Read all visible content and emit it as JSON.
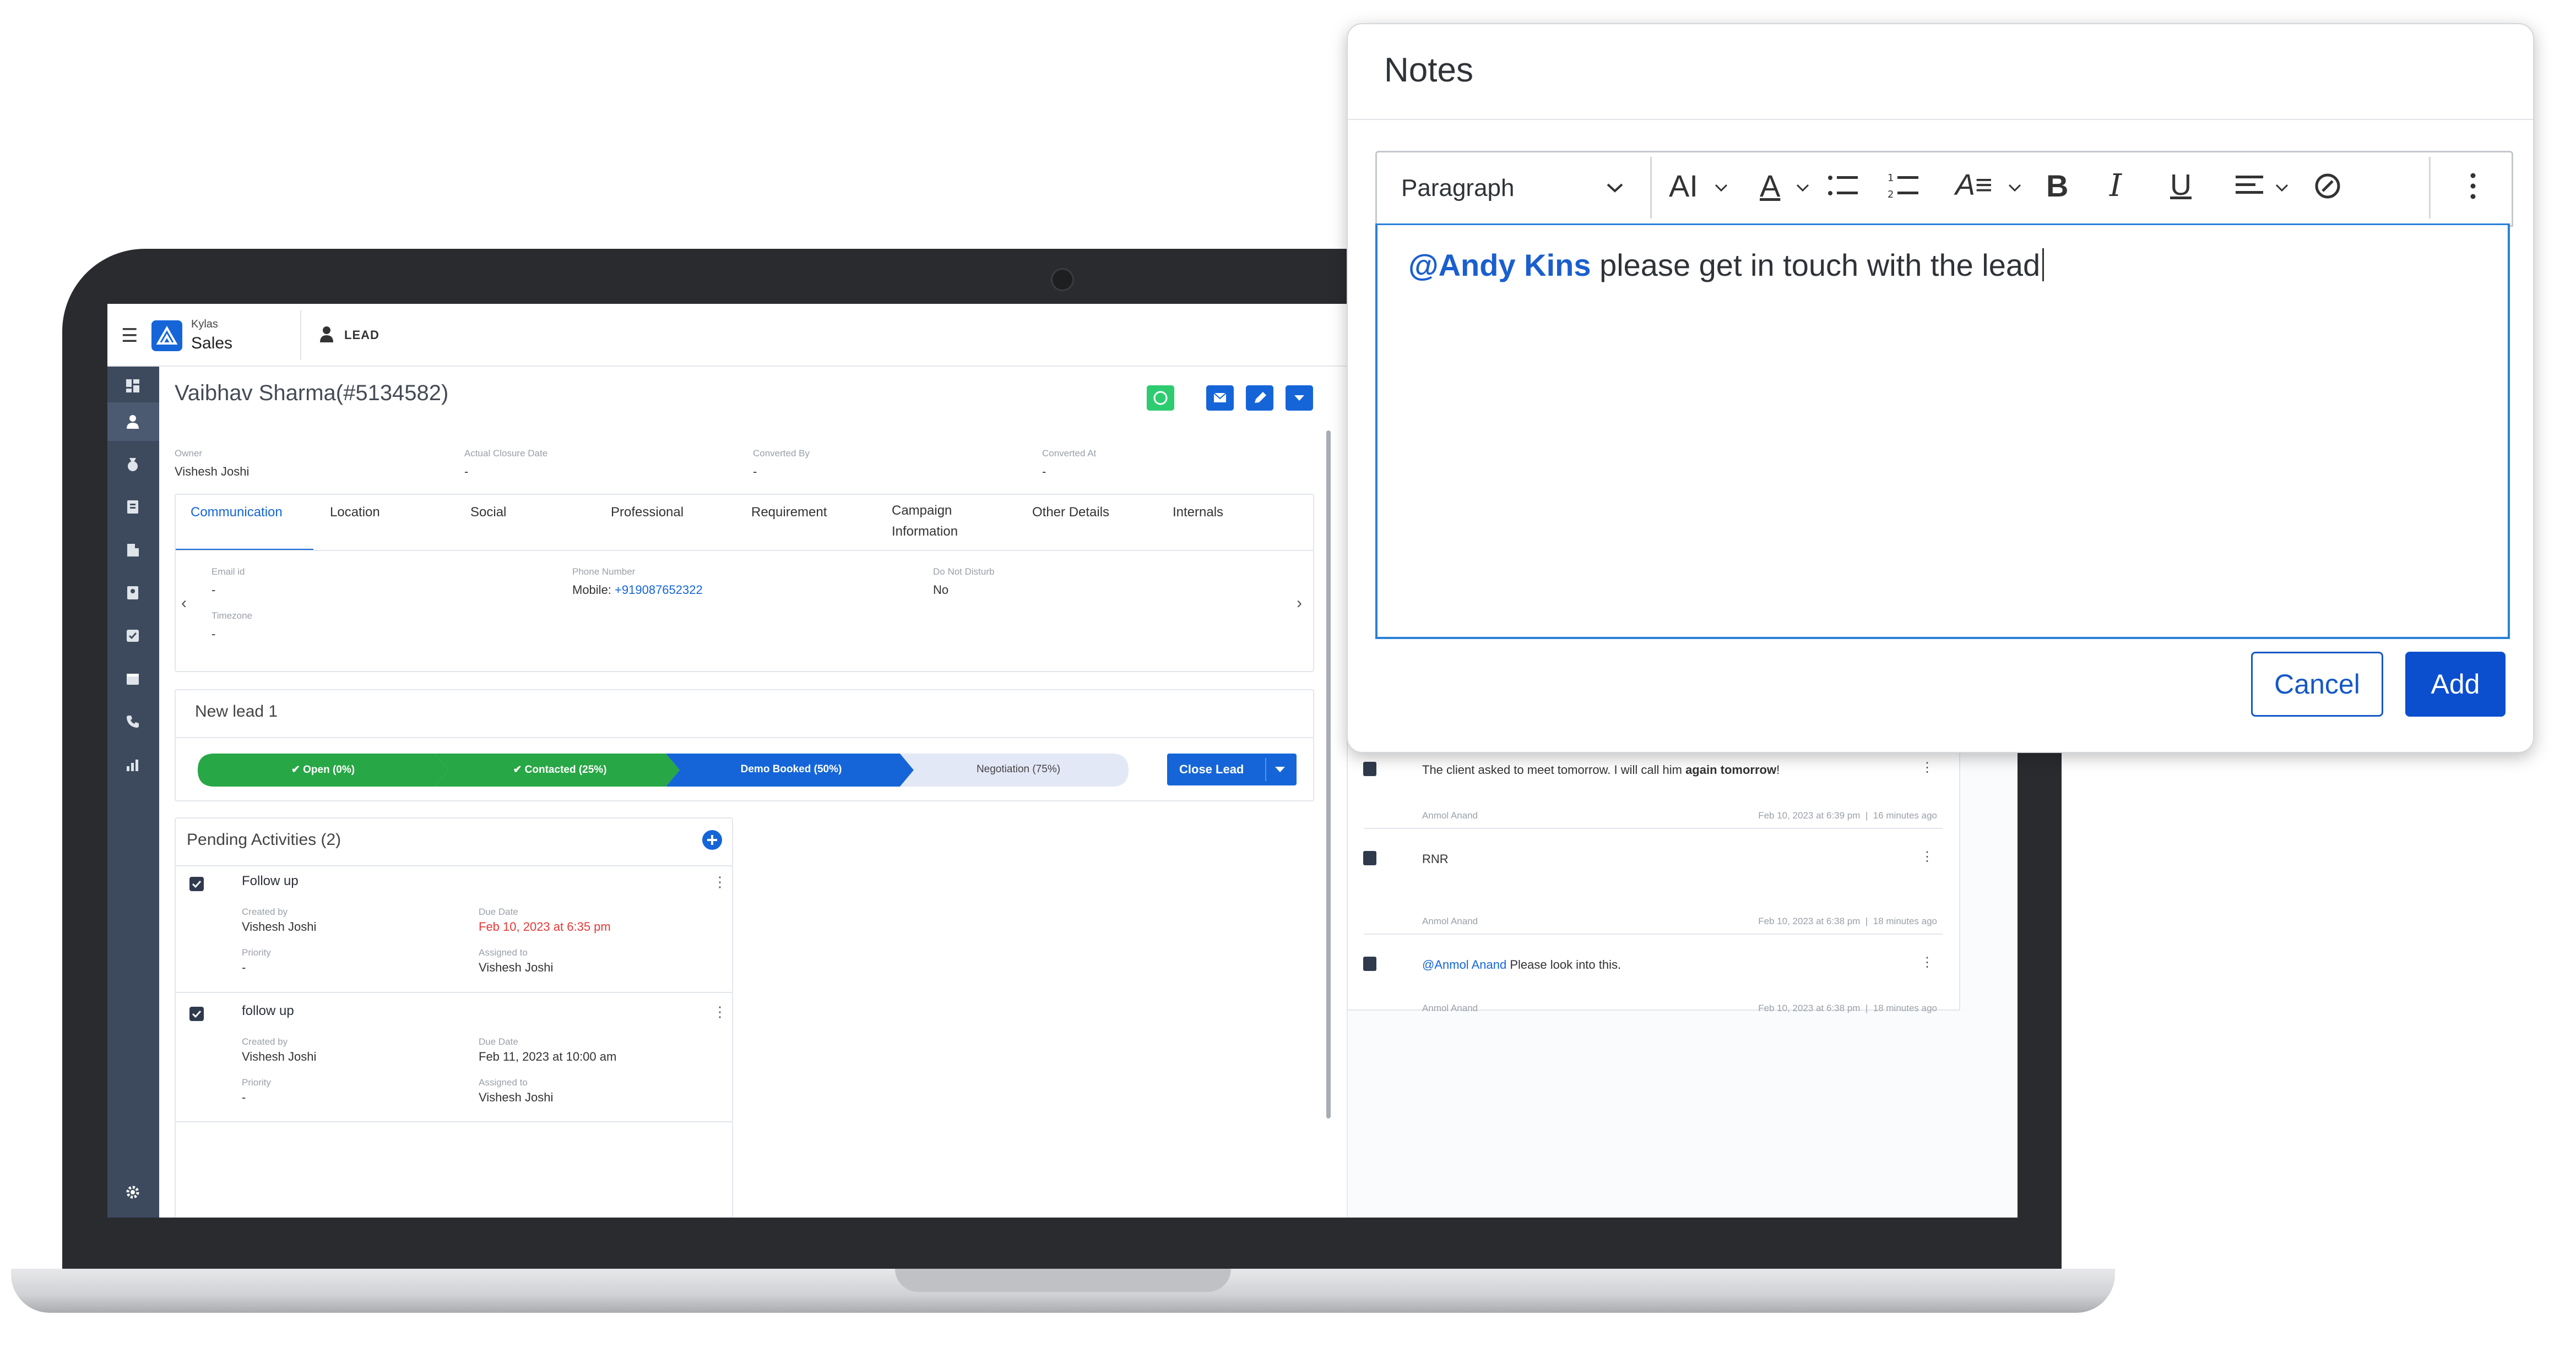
{
  "app": {
    "brand_small": "Kylas",
    "brand_name": "Sales",
    "module": "LEAD"
  },
  "lead": {
    "name": "Vaibhav Sharma(#5134582)",
    "fields": [
      {
        "label": "Owner",
        "value": "Vishesh Joshi"
      },
      {
        "label": "Actual Closure Date",
        "value": "-"
      },
      {
        "label": "Converted By",
        "value": "-"
      },
      {
        "label": "Converted At",
        "value": "-"
      }
    ]
  },
  "tabs": [
    "Communication",
    "Location",
    "Social",
    "Professional",
    "Requirement",
    "Campaign Information",
    "Other Details",
    "Internals"
  ],
  "communication": {
    "email_label": "Email id",
    "email_value": "-",
    "phone_label": "Phone Number",
    "phone_prefix": "Mobile:",
    "phone_value": "+919087652322",
    "dnd_label": "Do Not Disturb",
    "dnd_value": "No",
    "timezone_label": "Timezone",
    "timezone_value": "-"
  },
  "pipeline": {
    "title": "New lead 1",
    "stages": [
      {
        "label": "Open (0%)",
        "state": "done"
      },
      {
        "label": "Contacted (25%)",
        "state": "done"
      },
      {
        "label": "Demo Booked (50%)",
        "state": "current"
      },
      {
        "label": "Negotiation (75%)",
        "state": "pending"
      }
    ],
    "close_button": "Close Lead"
  },
  "pending": {
    "title": "Pending Activities (2)",
    "items": [
      {
        "title": "Follow up",
        "created_label": "Created by",
        "created_by": "Vishesh Joshi",
        "due_label": "Due Date",
        "due": "Feb 10, 2023 at 6:35 pm",
        "overdue": true,
        "priority_label": "Priority",
        "priority": "-",
        "assigned_label": "Assigned to",
        "assigned": "Vishesh Joshi"
      },
      {
        "title": "follow up",
        "created_label": "Created by",
        "created_by": "Vishesh Joshi",
        "due_label": "Due Date",
        "due": "Feb 11, 2023 at 10:00 am",
        "overdue": false,
        "priority_label": "Priority",
        "priority": "-",
        "assigned_label": "Assigned to",
        "assigned": "Vishesh Joshi"
      }
    ]
  },
  "notes_list": [
    {
      "text_before": "The client asked to meet tomorrow. I will call him ",
      "text_bold": "again tomorrow",
      "text_after": "!",
      "author": "Anmol Anand",
      "time": "Feb 10, 2023 at 6:39 pm",
      "ago": "16 minutes ago"
    },
    {
      "text_before": "RNR",
      "text_bold": "",
      "text_after": "",
      "author": "Anmol Anand",
      "time": "Feb 10, 2023 at 6:38 pm",
      "ago": "18 minutes ago"
    },
    {
      "mention": "@Anmol Anand",
      "text_before": " Please look into this.",
      "text_bold": "",
      "text_after": "",
      "author": "Anmol Anand",
      "time": "Feb 10, 2023 at 6:38 pm",
      "ago": "18 minutes ago"
    }
  ],
  "modal": {
    "title": "Notes",
    "paragraph_select": "Paragraph",
    "editor_mention": "@Andy Kins",
    "editor_text": " please get in touch with the lead",
    "cancel": "Cancel",
    "add": "Add"
  },
  "colors": {
    "primary": "#1565d8",
    "success": "#27a745",
    "sidebar": "#3d4a5e",
    "overdue": "#e53935",
    "whatsapp": "#2ecc71"
  }
}
